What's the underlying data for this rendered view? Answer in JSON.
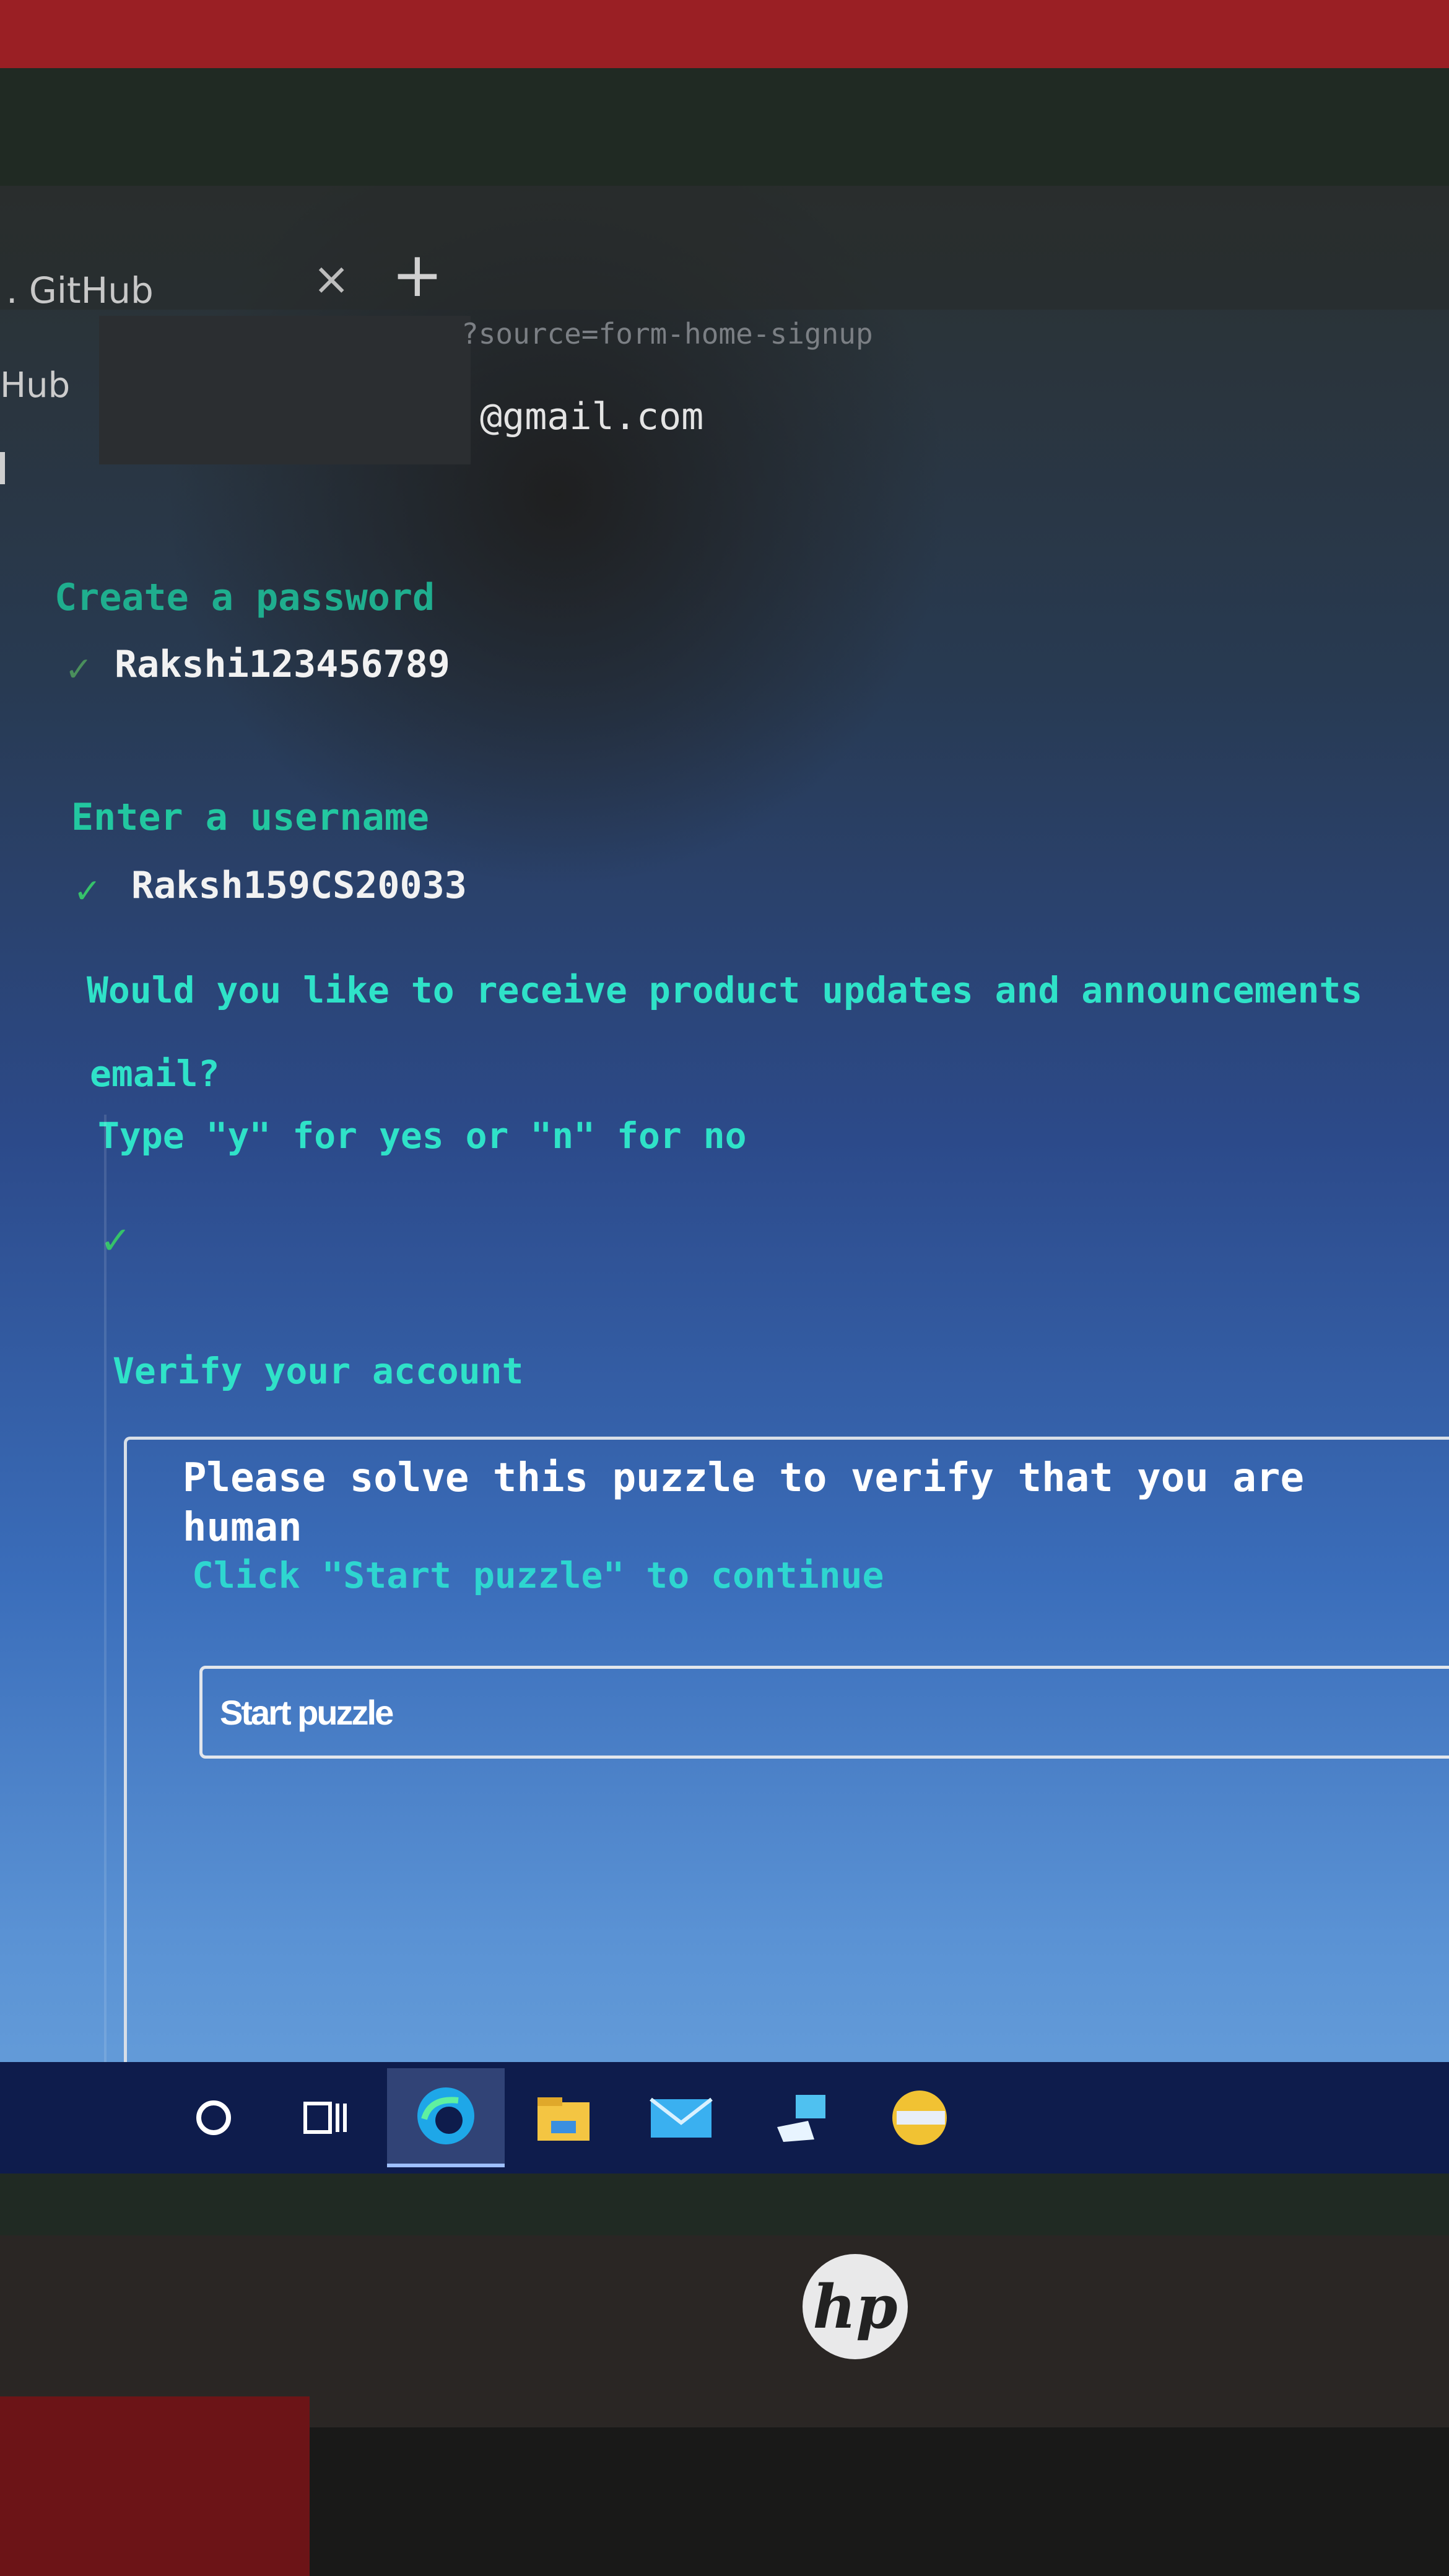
{
  "browser": {
    "tab_title": ". GitHub",
    "tab_close": "×",
    "new_tab": "+",
    "address_fragment": "?source=form-home-signup",
    "site_name": "Hub"
  },
  "signup": {
    "email_value": "@gmail.com",
    "password": {
      "label": "Create a password",
      "check": "✓",
      "value": "Rakshi123456789"
    },
    "username": {
      "label": "Enter a username",
      "check": "✓",
      "value": "Raksh159CS20033"
    },
    "updates": {
      "question_line1": "Would you like to receive product updates and announcements",
      "question_line2": "email?",
      "prompt": "Type \"y\" for yes or \"n\" for no",
      "check": "✓"
    },
    "verify": {
      "label": "Verify your account",
      "title_line1": "Please solve this puzzle to verify that you are",
      "title_line2": "human",
      "subtitle": "Click \"Start puzzle\" to continue",
      "button_label": "Start puzzle"
    }
  },
  "taskbar": {
    "items": [
      "cortana-circle-icon",
      "task-view-icon",
      "edge-icon",
      "file-explorer-icon",
      "mail-icon",
      "app-icon",
      "app-icon"
    ]
  },
  "monitor": {
    "brand": "hp"
  },
  "colors": {
    "accent_teal": "#22c7a0",
    "check_green": "#36c26a",
    "taskbar": "#0e1c4c"
  }
}
